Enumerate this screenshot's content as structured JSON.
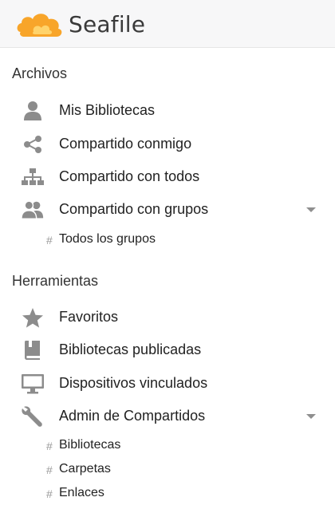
{
  "header": {
    "brand": "Seafile",
    "logo_colors": {
      "primary": "#f8a52a",
      "secondary": "#ffd36b"
    }
  },
  "sections": {
    "files_title": "Archivos",
    "tools_title": "Herramientas"
  },
  "files_nav": [
    {
      "label": "Mis Bibliotecas",
      "icon": "user-icon"
    },
    {
      "label": "Compartido conmigo",
      "icon": "share-icon"
    },
    {
      "label": "Compartido con todos",
      "icon": "org-chart-icon"
    },
    {
      "label": "Compartido con grupos",
      "icon": "group-icon",
      "expandable": true
    }
  ],
  "groups_sub": [
    {
      "hash": "#",
      "label": "Todos los grupos"
    }
  ],
  "tools_nav": [
    {
      "label": "Favoritos",
      "icon": "star-icon"
    },
    {
      "label": "Bibliotecas publicadas",
      "icon": "book-icon"
    },
    {
      "label": "Dispositivos vinculados",
      "icon": "monitor-icon"
    },
    {
      "label": "Admin de Compartidos",
      "icon": "wrench-icon",
      "expandable": true
    }
  ],
  "share_admin_sub": [
    {
      "hash": "#",
      "label": "Bibliotecas"
    },
    {
      "hash": "#",
      "label": "Carpetas"
    },
    {
      "hash": "#",
      "label": "Enlaces"
    }
  ],
  "colors": {
    "icon_gray": "#8c8c8c",
    "header_bg": "#f7f7f8"
  }
}
